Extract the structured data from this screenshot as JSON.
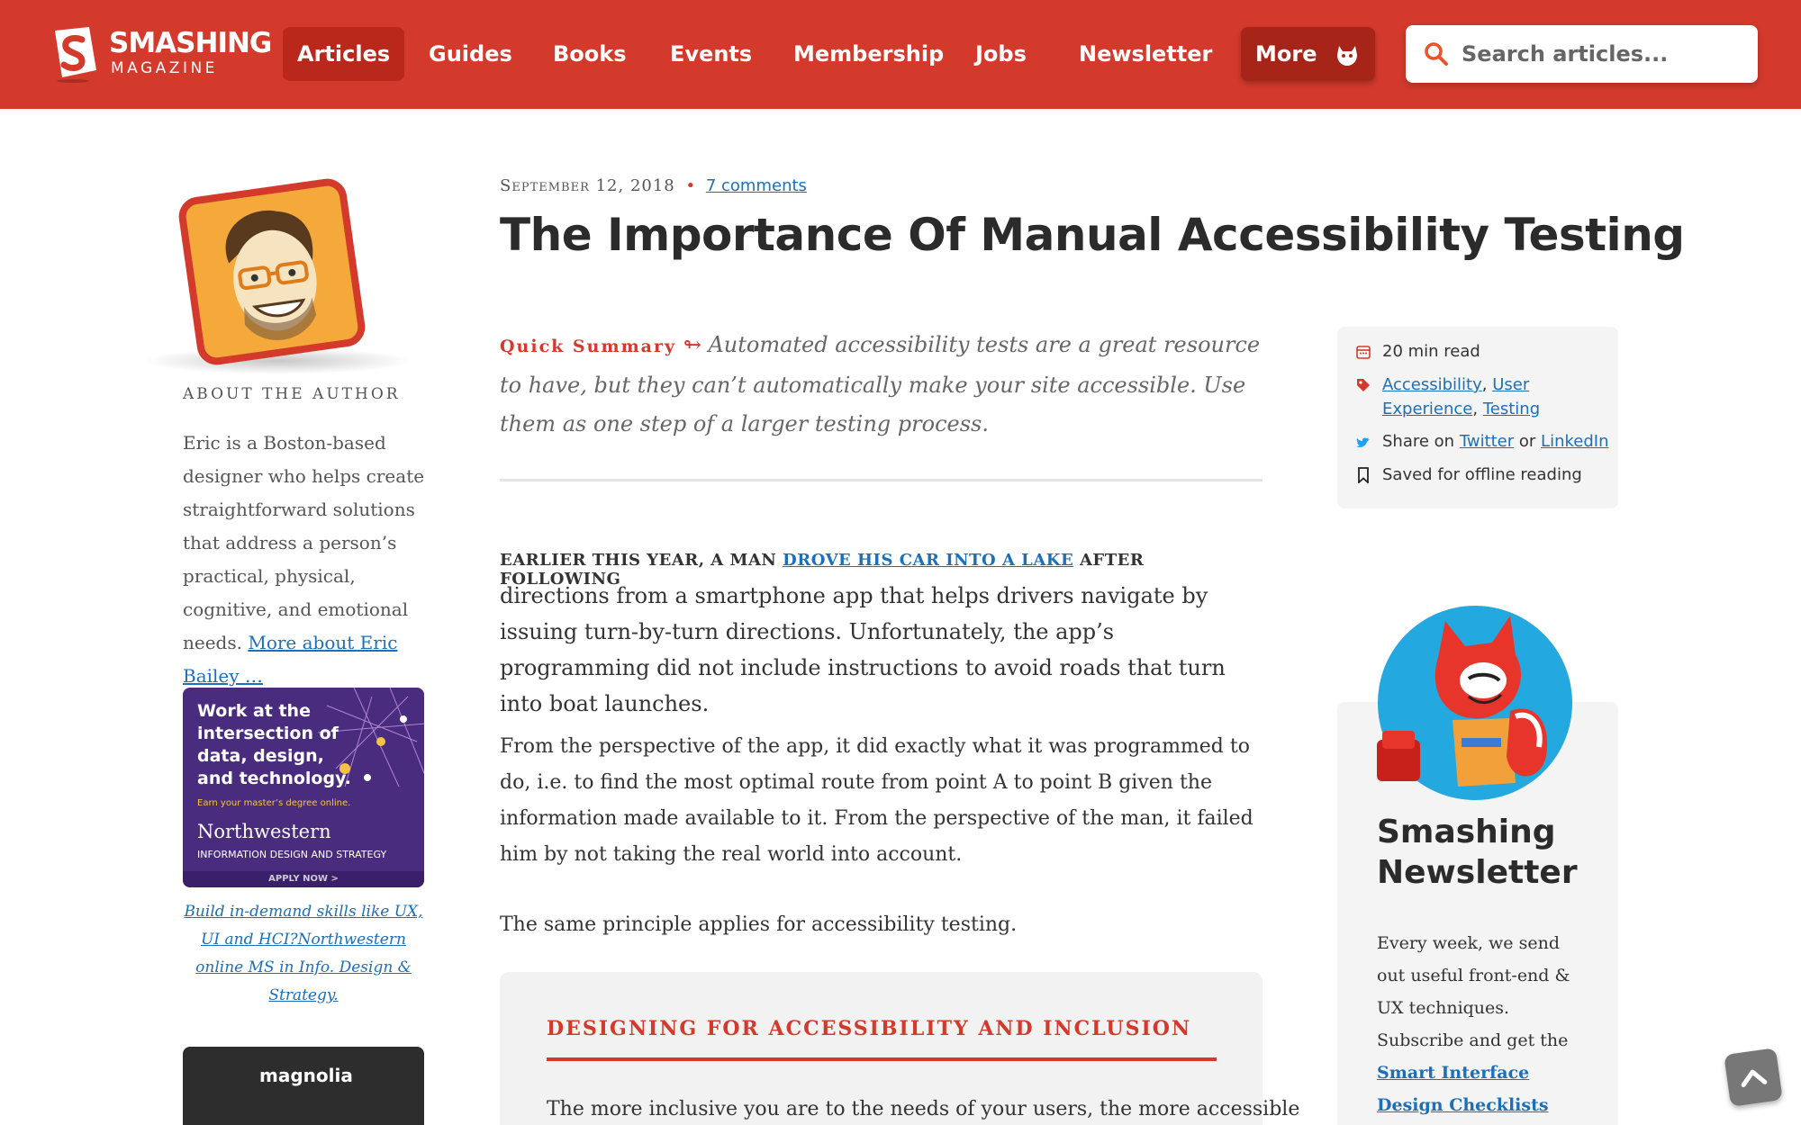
{
  "header": {
    "logo_line1": "SMASHING",
    "logo_line2": "MAGAZINE",
    "nav": [
      "Articles",
      "Guides",
      "Books",
      "Events",
      "Membership",
      "Jobs",
      "Newsletter"
    ],
    "more_label": "More",
    "search_placeholder": "Search articles..."
  },
  "author": {
    "about_label": "About The Author",
    "bio": "Eric is a Boston-based designer who helps create straightforward solutions that address a person’s practical, physical, cognitive, and emotional needs.",
    "more_link": "More about Eric Bailey …"
  },
  "ad": {
    "headline": "Work at the intersection of data, design, and technology.",
    "sub": "Earn your master’s degree online.",
    "brand": "Northwestern",
    "program": "INFORMATION DESIGN AND STRATEGY",
    "cta": "APPLY NOW >",
    "caption": "Build in-demand skills like UX, UI and HCI?Northwestern online MS in Info. Design & Strategy."
  },
  "ad2": {
    "brand": "magnolia"
  },
  "article": {
    "date": "September 12, 2018",
    "separator": "•",
    "comments": "7 comments",
    "title": "The Importance Of Manual Accessibility Testing",
    "summary_label": "Quick Summary",
    "summary_arrow": "↬",
    "summary": "Automated accessibility tests are a great resource to have, but they can’t automatically make your site accessible. Use them as one step of a larger testing process.",
    "lead_prefix": "EARLIER THIS YEAR, A MAN",
    "lead_link": "DROVE HIS CAR INTO A LAKE",
    "lead_suffix": "AFTER FOLLOWING",
    "para1": "directions from a smartphone app that helps drivers navigate by issuing turn-by-turn directions. Unfortunately, the app’s programming did not include instructions to avoid roads that turn into boat launches.",
    "para2": "From the perspective of the app, it did exactly what it was programmed to do, i.e. to find the most optimal route from point A to point B given the information made available to it. From the perspective of the man, it failed him by not taking the real world into account.",
    "para3": "The same principle applies for accessibility testing.",
    "inset_heading": "Designing For Accessibility And Inclusion",
    "inset_text": "The more inclusive you are to the needs of your users, the more accessible"
  },
  "sidebar": {
    "read_time": "20 min read",
    "tags": [
      "Accessibility",
      "User Experience",
      "Testing"
    ],
    "share_label": "Share on",
    "share_or": "or",
    "share_twitter": "Twitter",
    "share_linkedin": "LinkedIn",
    "saved": "Saved for offline reading",
    "newsletter_title": "Smashing Newsletter",
    "newsletter_text": "Every week, we send out useful front-end & UX techniques. Subscribe and get the",
    "newsletter_link": "Smart Interface Design Checklists PDF"
  },
  "colors": {
    "brand_red": "#d33a2c",
    "link_blue": "#1c6fb8"
  }
}
